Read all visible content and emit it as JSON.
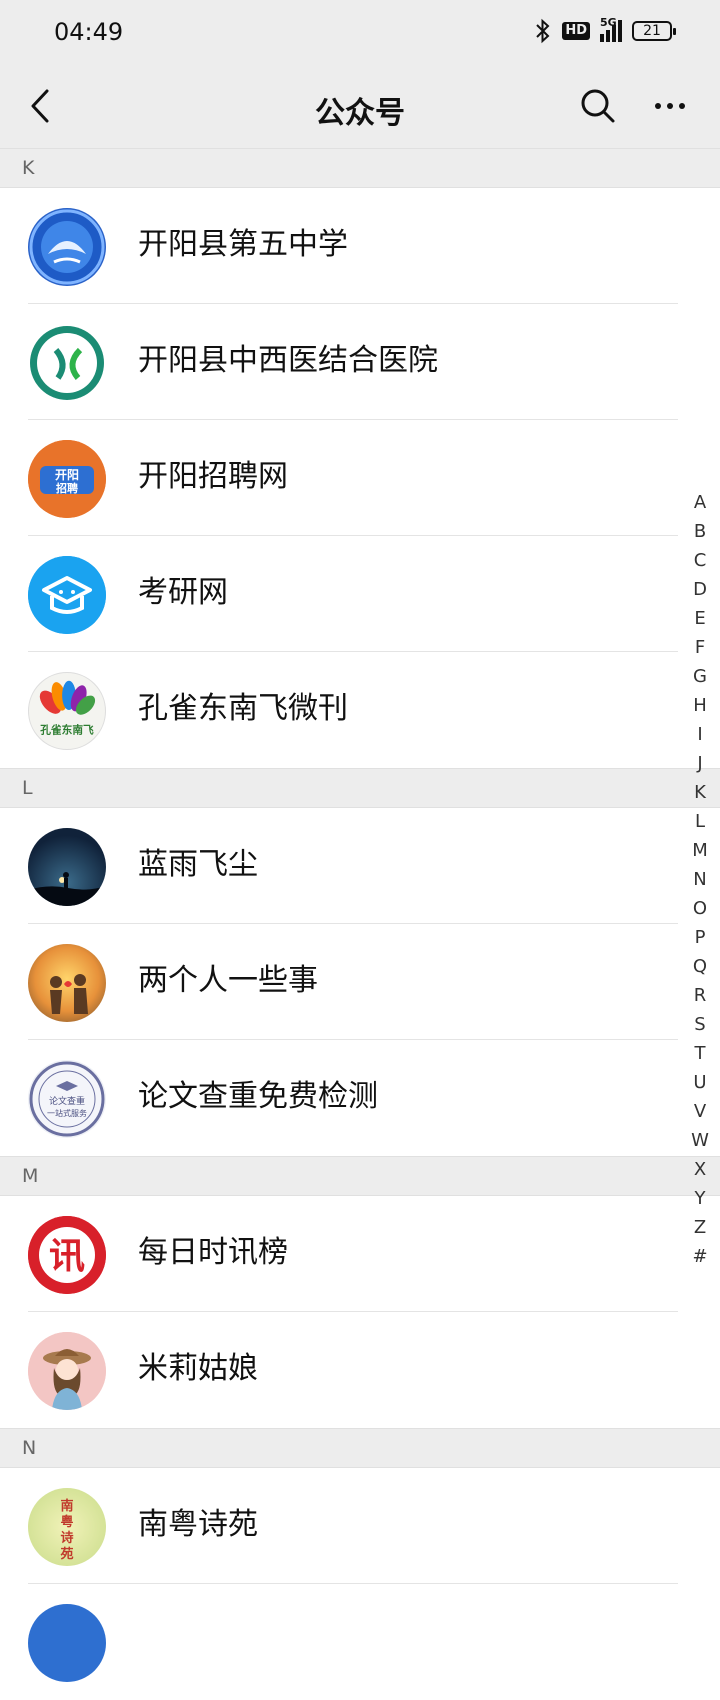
{
  "status": {
    "time": "04:49",
    "hd": "HD",
    "network": "5G",
    "battery": "21"
  },
  "nav": {
    "title": "公众号"
  },
  "sections": [
    {
      "letter": "K",
      "items": [
        {
          "name": "开阳县第五中学",
          "avatar": "school-logo"
        },
        {
          "name": "开阳县中西医结合医院",
          "avatar": "hospital-logo"
        },
        {
          "name": "开阳招聘网",
          "avatar": "recruit-logo",
          "avatar_text": "开阳招聘"
        },
        {
          "name": "考研网",
          "avatar": "graduation-cap-logo"
        },
        {
          "name": "孔雀东南飞微刊",
          "avatar": "peacock-logo",
          "avatar_text": "孔雀东南飞"
        }
      ]
    },
    {
      "letter": "L",
      "items": [
        {
          "name": "蓝雨飞尘",
          "avatar": "night-sky-photo"
        },
        {
          "name": "两个人一些事",
          "avatar": "sunset-couple-photo"
        },
        {
          "name": "论文查重免费检测",
          "avatar": "paper-check-logo",
          "avatar_text": "论文查重 一站式服务"
        }
      ]
    },
    {
      "letter": "M",
      "items": [
        {
          "name": "每日时讯榜",
          "avatar": "xun-logo",
          "avatar_text": "讯"
        },
        {
          "name": "米莉姑娘",
          "avatar": "girl-illustration"
        }
      ]
    },
    {
      "letter": "N",
      "items": [
        {
          "name": "南粤诗苑",
          "avatar": "poetry-logo",
          "avatar_text": "南粤诗苑"
        }
      ]
    }
  ],
  "index_letters": [
    "A",
    "B",
    "C",
    "D",
    "E",
    "F",
    "G",
    "H",
    "I",
    "J",
    "K",
    "L",
    "M",
    "N",
    "O",
    "P",
    "Q",
    "R",
    "S",
    "T",
    "U",
    "V",
    "W",
    "X",
    "Y",
    "Z",
    "#"
  ]
}
